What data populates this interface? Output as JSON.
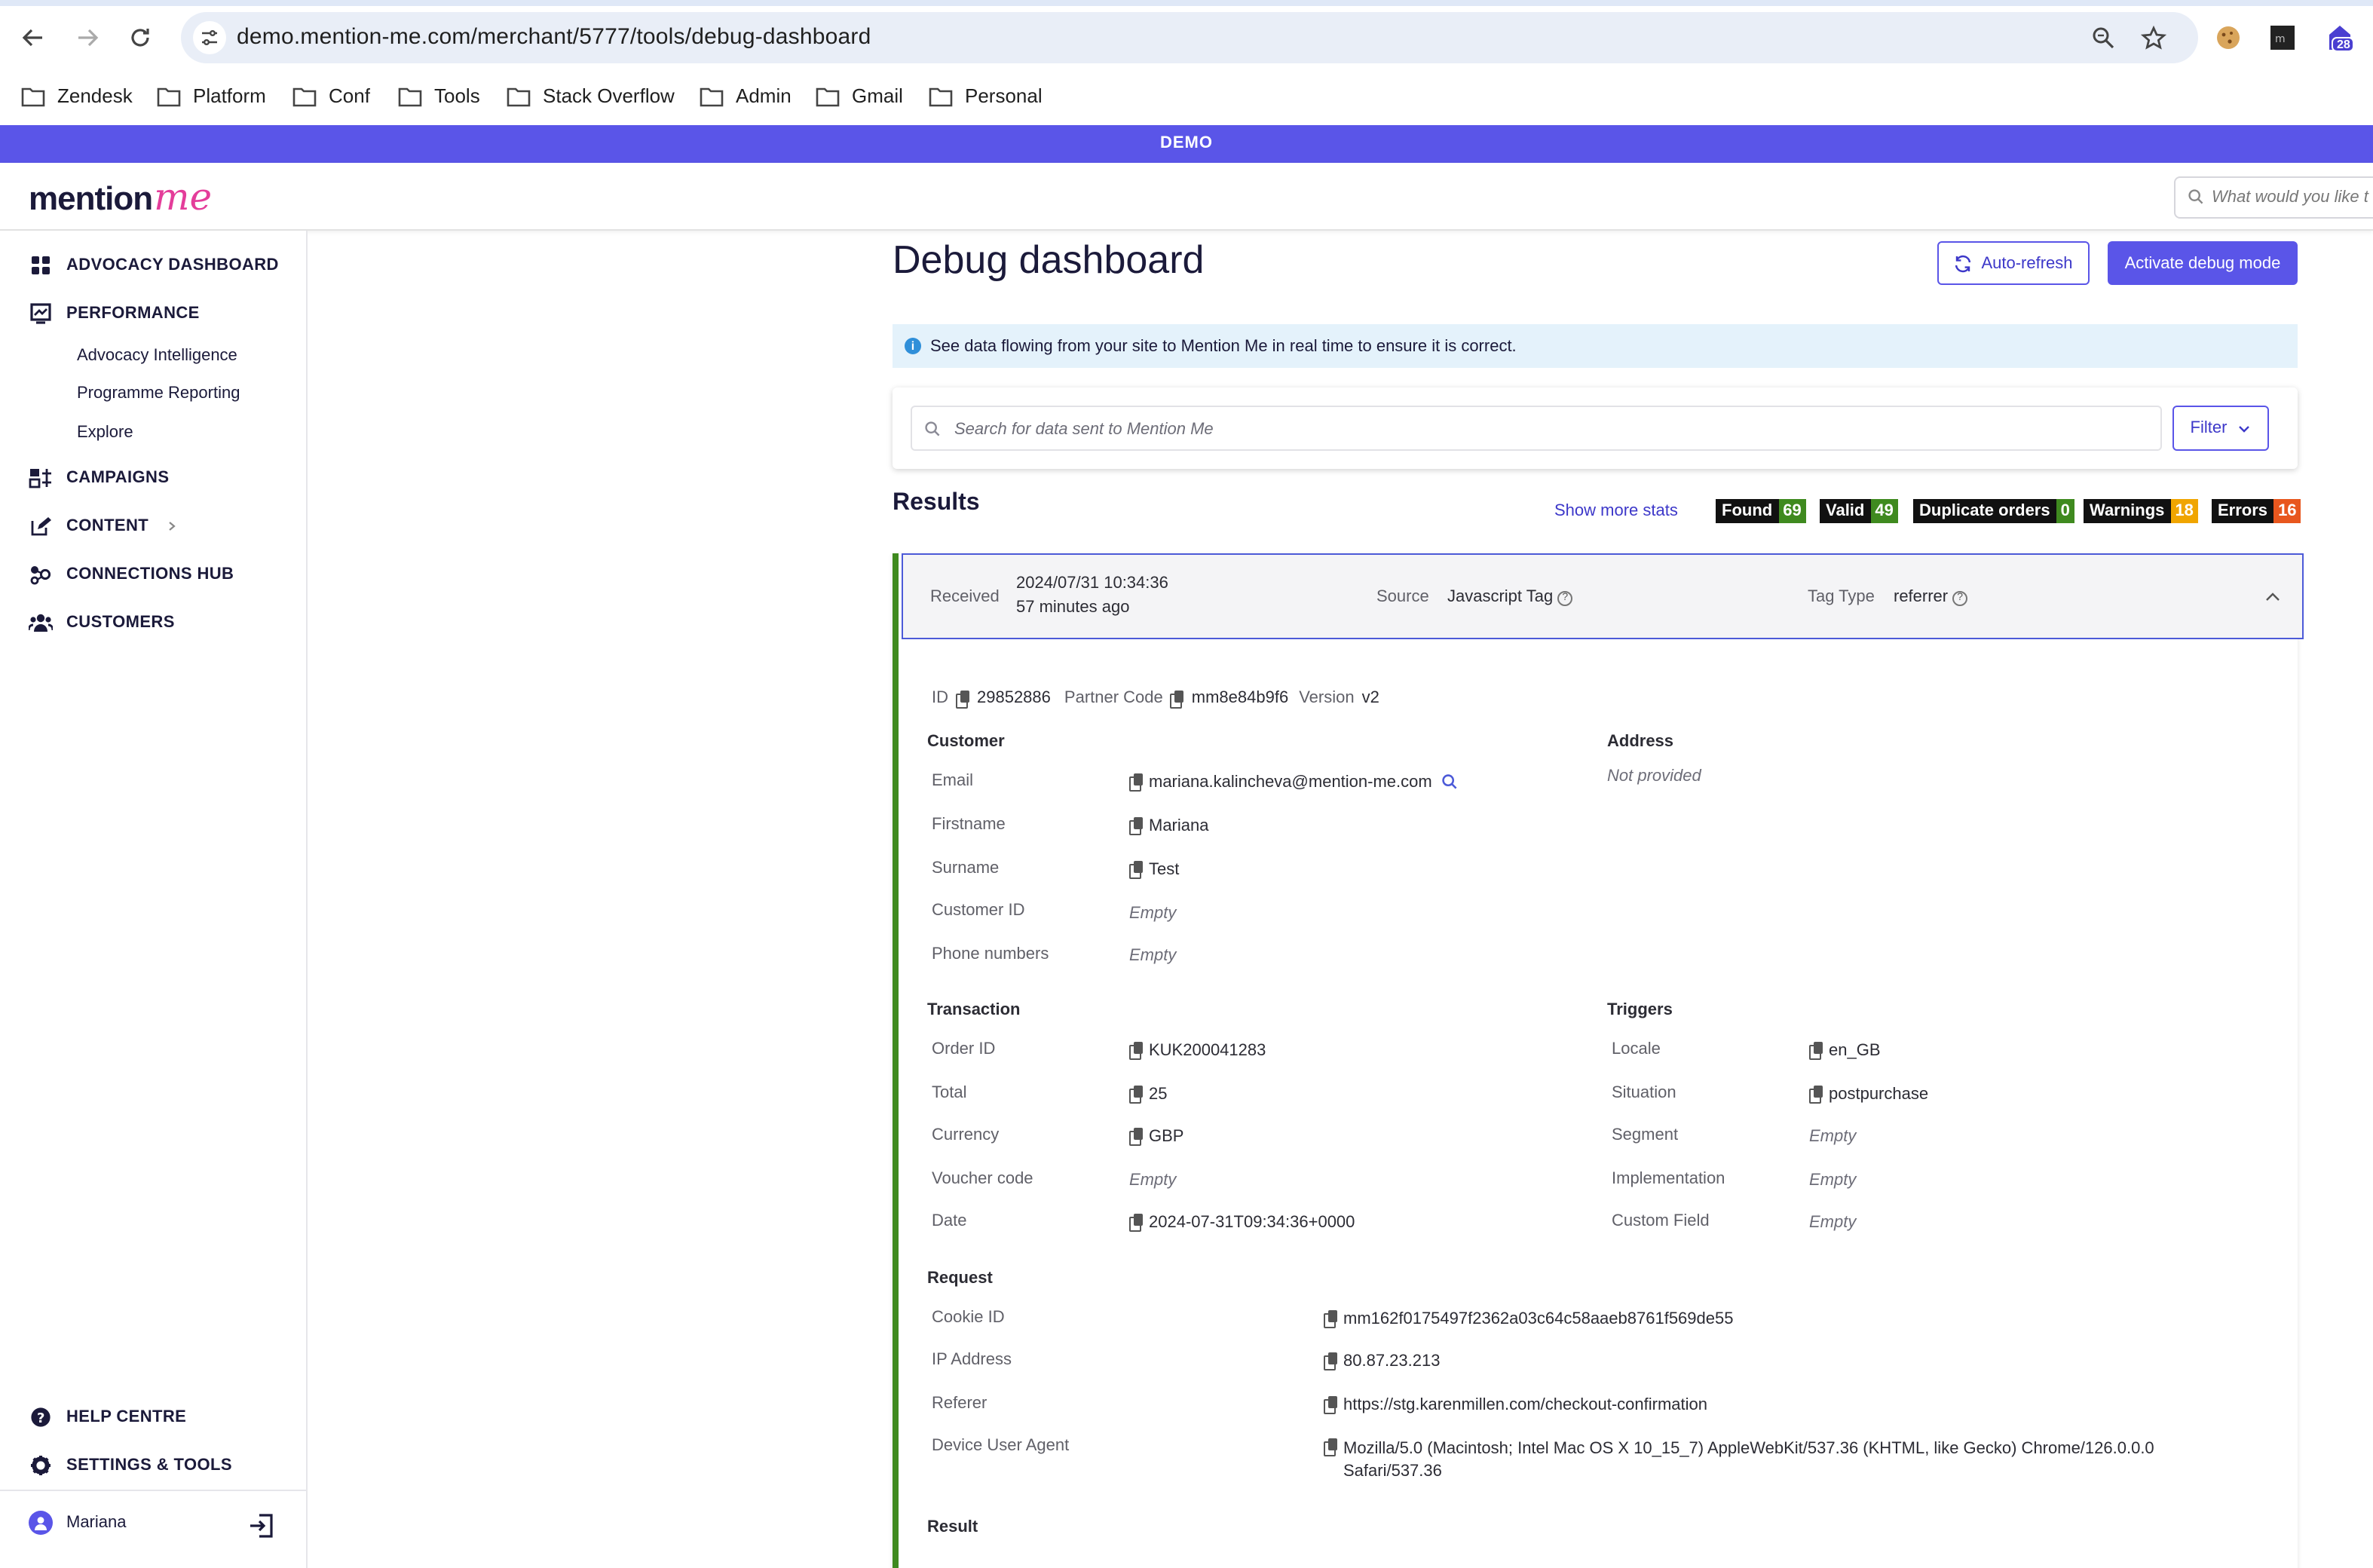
{
  "browser": {
    "url": "demo.mention-me.com/merchant/5777/tools/debug-dashboard",
    "bookmarks": [
      "Zendesk",
      "Platform",
      "Conf",
      "Tools",
      "Stack Overflow",
      "Admin",
      "Gmail",
      "Personal"
    ],
    "extension_badge": "28"
  },
  "app": {
    "env_banner": "DEMO",
    "logo_part1": "mention",
    "logo_part2": "me",
    "global_search_placeholder": "What would you like t"
  },
  "sidebar": {
    "items": [
      {
        "label": "ADVOCACY DASHBOARD",
        "icon": "grid-icon"
      },
      {
        "label": "PERFORMANCE",
        "icon": "chart-icon"
      },
      {
        "label": "CAMPAIGNS",
        "icon": "campaigns-icon"
      },
      {
        "label": "CONTENT",
        "icon": "edit-icon"
      },
      {
        "label": "CONNECTIONS HUB",
        "icon": "connections-icon"
      },
      {
        "label": "CUSTOMERS",
        "icon": "users-icon"
      }
    ],
    "performance_sub": [
      "Advocacy Intelligence",
      "Programme Reporting",
      "Explore"
    ],
    "help": "HELP CENTRE",
    "settings": "SETTINGS & TOOLS",
    "user": "Mariana"
  },
  "main": {
    "title": "Debug dashboard",
    "auto_refresh": "Auto-refresh",
    "activate": "Activate debug mode",
    "info": "See data flowing from your site to Mention Me in real time to ensure it is correct.",
    "search_placeholder": "Search for data sent to Mention Me",
    "filter": "Filter",
    "results_title": "Results",
    "show_more_stats": "Show more stats",
    "stats": [
      {
        "label": "Found",
        "value": "69",
        "color": "#3f8a1f"
      },
      {
        "label": "Valid",
        "value": "49",
        "color": "#3f8a1f"
      },
      {
        "label": "Duplicate orders",
        "value": "0",
        "color": "#3f8a1f"
      },
      {
        "label": "Warnings",
        "value": "18",
        "color": "#f0a500"
      },
      {
        "label": "Errors",
        "value": "16",
        "color": "#e8571e"
      }
    ]
  },
  "record": {
    "received_label": "Received",
    "received_date": "2024/07/31 10:34:36",
    "received_ago": "57 minutes ago",
    "source_label": "Source",
    "source_value": "Javascript Tag",
    "tag_type_label": "Tag Type",
    "tag_type_value": "referrer",
    "id_label": "ID",
    "id_value": "29852886",
    "partner_label": "Partner Code",
    "partner_value": "mm8e84b9f6",
    "version_label": "Version",
    "version_value": "v2",
    "customer_title": "Customer",
    "address_title": "Address",
    "address_value": "Not provided",
    "customer": {
      "email_label": "Email",
      "email": "mariana.kalincheva@mention-me.com",
      "firstname_label": "Firstname",
      "firstname": "Mariana",
      "surname_label": "Surname",
      "surname": "Test",
      "customer_id_label": "Customer ID",
      "customer_id": "Empty",
      "phone_label": "Phone numbers",
      "phone": "Empty"
    },
    "transaction_title": "Transaction",
    "transaction": {
      "order_id_label": "Order ID",
      "order_id": "KUK200041283",
      "total_label": "Total",
      "total": "25",
      "currency_label": "Currency",
      "currency": "GBP",
      "voucher_label": "Voucher code",
      "voucher": "Empty",
      "date_label": "Date",
      "date": "2024-07-31T09:34:36+0000"
    },
    "triggers_title": "Triggers",
    "triggers": {
      "locale_label": "Locale",
      "locale": "en_GB",
      "situation_label": "Situation",
      "situation": "postpurchase",
      "segment_label": "Segment",
      "segment": "Empty",
      "implementation_label": "Implementation",
      "implementation": "Empty",
      "custom_label": "Custom Field",
      "custom": "Empty"
    },
    "request_title": "Request",
    "request": {
      "cookie_label": "Cookie ID",
      "cookie": "mm162f0175497f2362a03c64c58aaeb8761f569de55",
      "ip_label": "IP Address",
      "ip": "80.87.23.213",
      "referer_label": "Referer",
      "referer": "https://stg.karenmillen.com/checkout-confirmation",
      "ua_label": "Device User Agent",
      "ua_line1": "Mozilla/5.0 (Macintosh; Intel Mac OS X 10_15_7) AppleWebKit/537.36 (KHTML, like Gecko) Chrome/126.0.0.0",
      "ua_line2": "Safari/537.36"
    },
    "result_title": "Result"
  }
}
